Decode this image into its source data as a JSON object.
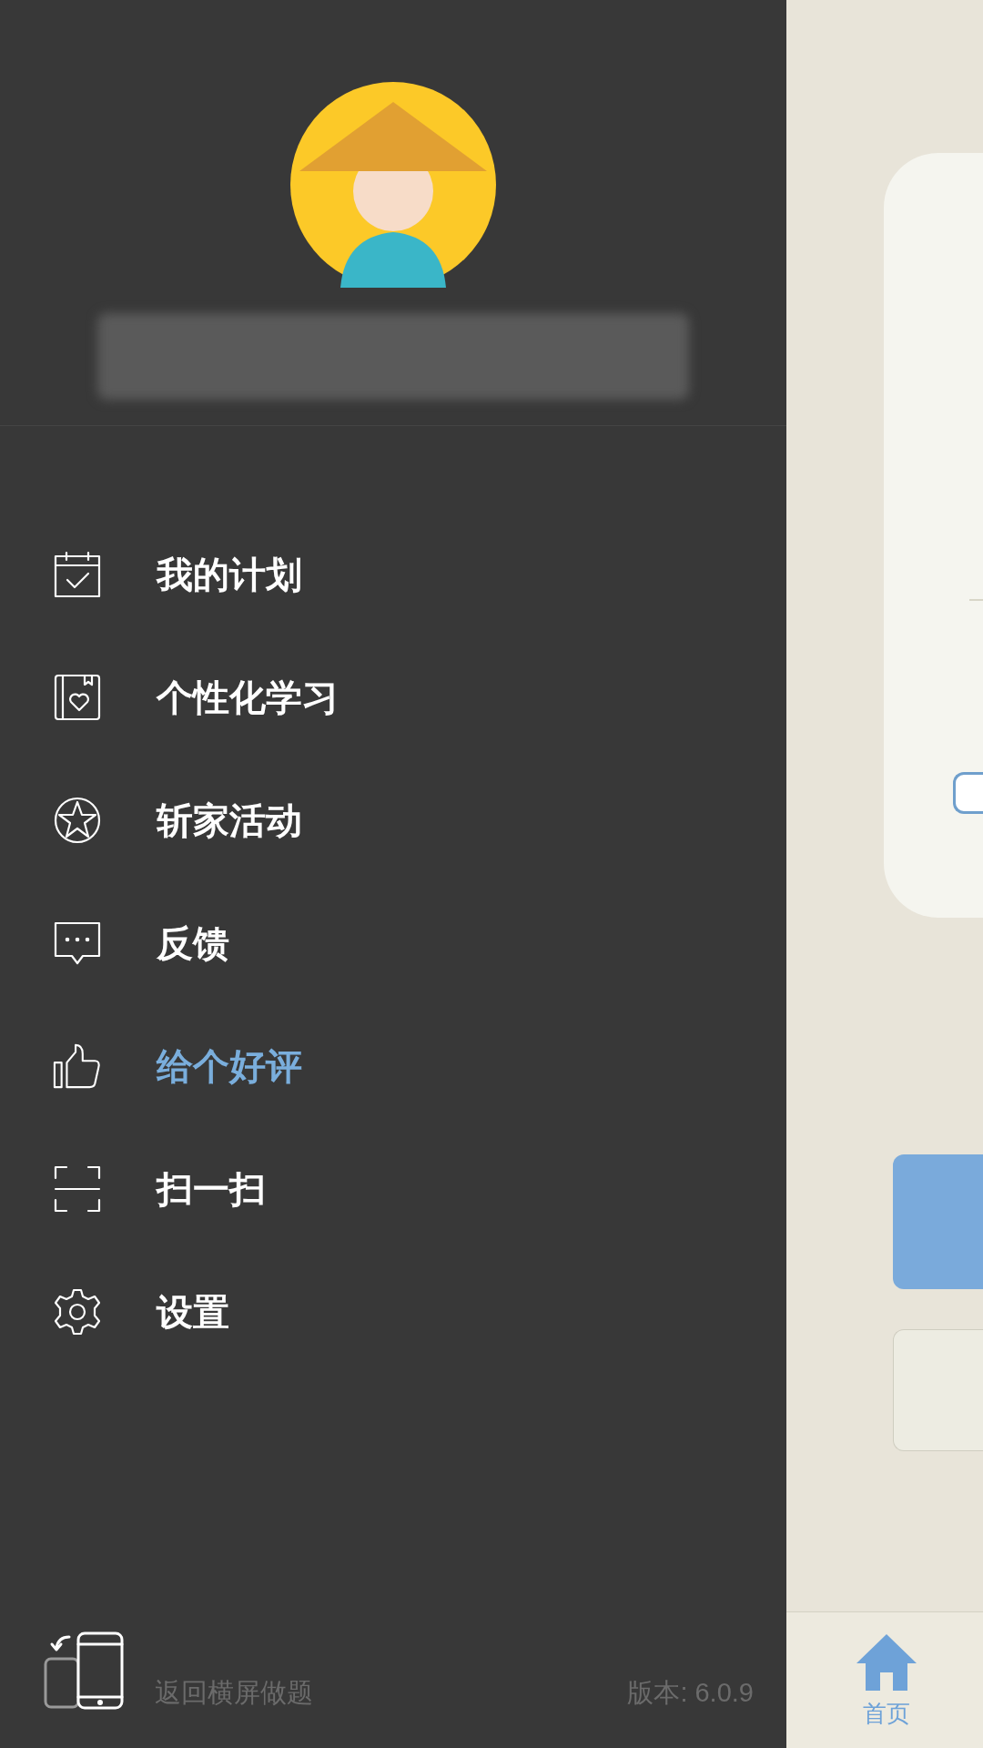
{
  "drawer": {
    "items": [
      {
        "label": "我的计划",
        "selected": false
      },
      {
        "label": "个性化学习",
        "selected": false
      },
      {
        "label": "斩家活动",
        "selected": false
      },
      {
        "label": "反馈",
        "selected": false
      },
      {
        "label": "给个好评",
        "selected": true
      },
      {
        "label": "扫一扫",
        "selected": false
      },
      {
        "label": "设置",
        "selected": false
      }
    ],
    "footer": {
      "rotate_label": "返回横屏做题",
      "version": "版本: 6.0.9"
    }
  },
  "bottom_nav": [
    {
      "label": "首页",
      "selected": true
    }
  ]
}
